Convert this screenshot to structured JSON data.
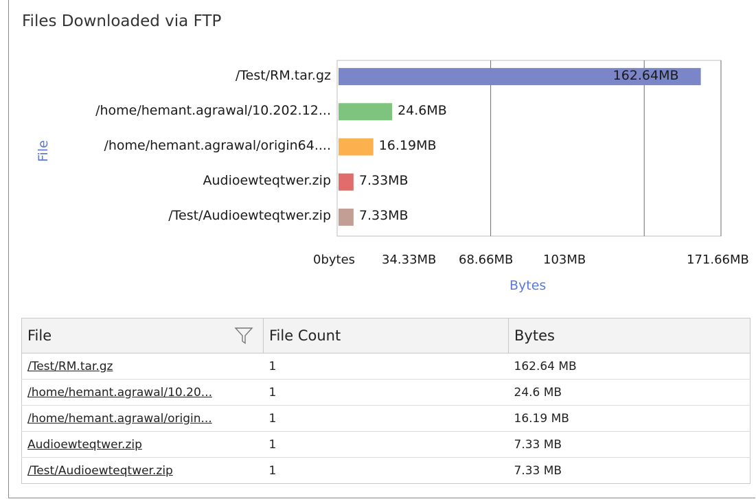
{
  "widget": {
    "title": "Files Downloaded via FTP"
  },
  "chart_data": {
    "type": "bar",
    "orientation": "horizontal",
    "categories": [
      "/Test/RM.tar.gz",
      "/home/hemant.agrawal/10.202.12...",
      "/home/hemant.agrawal/origin64....",
      "Audioewteqtwer.zip",
      "/Test/Audioewteqtwer.zip"
    ],
    "values_mb": [
      162.64,
      24.6,
      16.19,
      7.33,
      7.33
    ],
    "data_labels": [
      "162.64MB",
      "24.6MB",
      "16.19MB",
      "7.33MB",
      "7.33MB"
    ],
    "colors": [
      "#7b86c9",
      "#7ec47e",
      "#fbb24e",
      "#e06c6c",
      "#c29e94"
    ],
    "xlabel": "Bytes",
    "ylabel": "File",
    "x_ticks": [
      {
        "label": "0bytes",
        "value": 0
      },
      {
        "label": "34.33MB",
        "value": 34.33
      },
      {
        "label": "68.66MB",
        "value": 68.66
      },
      {
        "label": "103MB",
        "value": 103
      },
      {
        "label": "171.66MB",
        "value": 171.66
      }
    ],
    "gridlines": [
      68.66,
      137.33,
      171.66
    ],
    "xlim": [
      0,
      171.66
    ],
    "grid": true,
    "legend": "none"
  },
  "table": {
    "headers": {
      "file": "File",
      "count": "File Count",
      "bytes": "Bytes"
    },
    "rows": [
      {
        "file": "/Test/RM.tar.gz",
        "count": "1",
        "bytes": "162.64 MB"
      },
      {
        "file": "/home/hemant.agrawal/10.20...",
        "count": "1",
        "bytes": "24.6 MB"
      },
      {
        "file": "/home/hemant.agrawal/origin...",
        "count": "1",
        "bytes": "16.19 MB"
      },
      {
        "file": "Audioewteqtwer.zip",
        "count": "1",
        "bytes": "7.33 MB"
      },
      {
        "file": "/Test/Audioewteqtwer.zip",
        "count": "1",
        "bytes": "7.33 MB"
      }
    ]
  },
  "icons": {
    "filter": "filter-icon"
  }
}
